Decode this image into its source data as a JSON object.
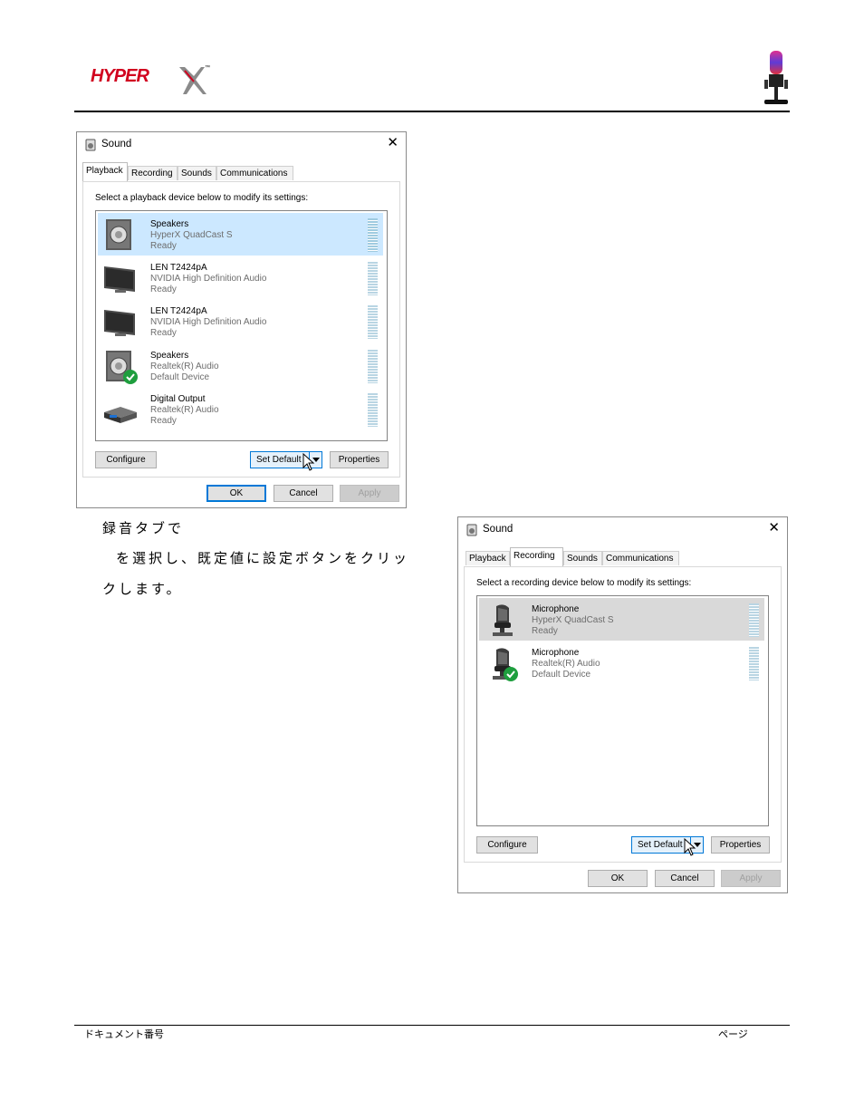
{
  "header": {
    "logo_text": "HYPERX",
    "trademark": "™"
  },
  "body_text": {
    "line1": "録音タブで",
    "line2": "を選択し、既定値に設定ボタンをクリッ",
    "line3": "クします。"
  },
  "footer": {
    "left": "ドキュメント番号",
    "right": "ページ"
  },
  "dialogs": [
    {
      "title": "Sound",
      "close": "✕",
      "tabs": [
        "Playback",
        "Recording",
        "Sounds",
        "Communications"
      ],
      "active_tab": "Playback",
      "instruction": "Select a playback device below to modify its settings:",
      "devices": [
        {
          "name": "Speakers",
          "sub": "HyperX QuadCast S",
          "status": "Ready",
          "icon": "speaker-icon",
          "selected": true
        },
        {
          "name": "LEN T2424pA",
          "sub": "NVIDIA High Definition Audio",
          "status": "Ready",
          "icon": "monitor-icon",
          "selected": false
        },
        {
          "name": "LEN T2424pA",
          "sub": "NVIDIA High Definition Audio",
          "status": "Ready",
          "icon": "monitor-icon",
          "selected": false
        },
        {
          "name": "Speakers",
          "sub": "Realtek(R) Audio",
          "status": "Default Device",
          "icon": "speaker-default-icon",
          "selected": false
        },
        {
          "name": "Digital Output",
          "sub": "Realtek(R) Audio",
          "status": "Ready",
          "icon": "digital-output-icon",
          "selected": false
        }
      ],
      "buttons": {
        "configure": "Configure",
        "set_default": "Set Default",
        "properties": "Properties",
        "ok": "OK",
        "cancel": "Cancel",
        "apply": "Apply"
      }
    },
    {
      "title": "Sound",
      "close": "✕",
      "tabs": [
        "Playback",
        "Recording",
        "Sounds",
        "Communications"
      ],
      "active_tab": "Recording",
      "instruction": "Select a recording device below to modify its settings:",
      "devices": [
        {
          "name": "Microphone",
          "sub": "HyperX QuadCast S",
          "status": "Ready",
          "icon": "microphone-icon",
          "selected": true
        },
        {
          "name": "Microphone",
          "sub": "Realtek(R) Audio",
          "status": "Default Device",
          "icon": "microphone-default-icon",
          "selected": false
        }
      ],
      "buttons": {
        "configure": "Configure",
        "set_default": "Set Default",
        "properties": "Properties",
        "ok": "OK",
        "cancel": "Cancel",
        "apply": "Apply"
      }
    }
  ]
}
